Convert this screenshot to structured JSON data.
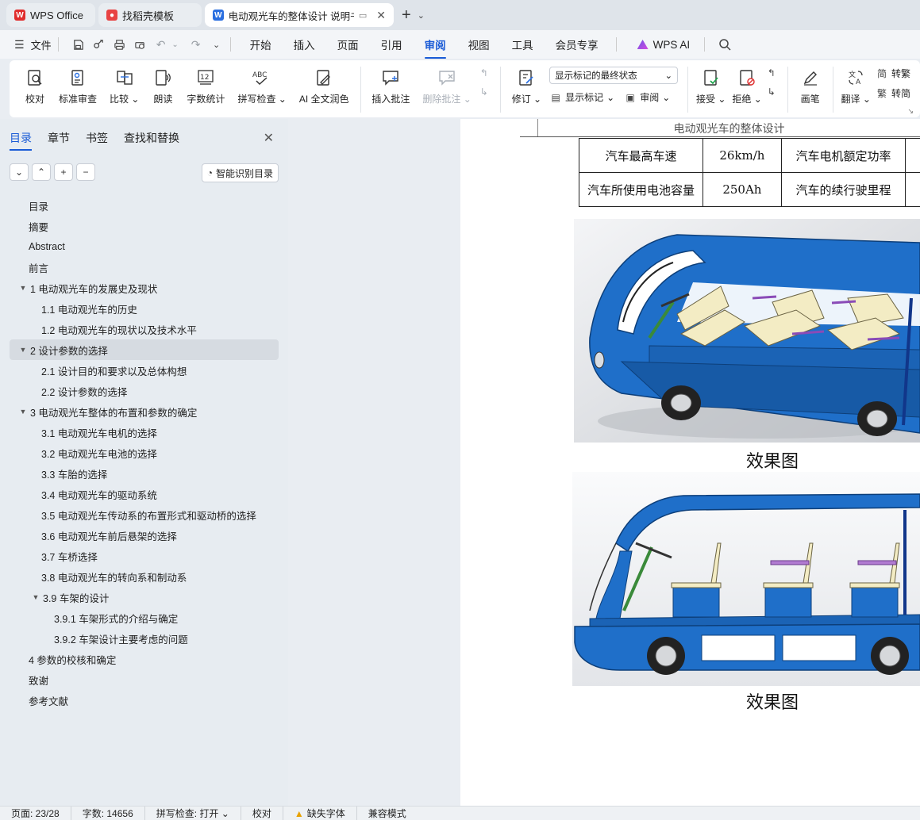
{
  "tabs": [
    {
      "label": "WPS Office",
      "icon": "wps-logo-icon",
      "color": "#e02d2d"
    },
    {
      "label": "找稻壳模板",
      "icon": "docer-logo-icon",
      "color": "#e84343"
    },
    {
      "label": "电动观光车的整体设计 说明书",
      "icon": "word-logo-icon",
      "color": "#2a6fe0"
    }
  ],
  "menu": {
    "file": "文件",
    "items": [
      "开始",
      "插入",
      "页面",
      "引用",
      "审阅",
      "视图",
      "工具",
      "会员专享"
    ],
    "active": "审阅",
    "ai": "WPS AI"
  },
  "ribbon": {
    "proofread": "校对",
    "std_review": "标准审查",
    "compare": "比较",
    "read_aloud": "朗读",
    "word_count": "字数统计",
    "spell_check": "拼写检查",
    "ai_polish": "AI 全文润色",
    "insert_comment": "插入批注",
    "delete_comment": "删除批注",
    "track_changes": "修订",
    "markup_select": "显示标记的最终状态",
    "show_markup": "显示标记",
    "review_pane": "审阅",
    "accept": "接受",
    "reject": "拒绝",
    "ink": "画笔",
    "translate": "翻译",
    "to_traditional": "转繁",
    "to_simplified": "转简"
  },
  "panel": {
    "tabs": [
      "目录",
      "章节",
      "书签",
      "查找和替换"
    ],
    "smart_toc": "智能识别目录",
    "toc": [
      {
        "level": 0,
        "label": "目录",
        "caret": ""
      },
      {
        "level": 0,
        "label": "摘要",
        "caret": ""
      },
      {
        "level": 0,
        "label": "Abstract",
        "caret": ""
      },
      {
        "level": 0,
        "label": "前言",
        "caret": ""
      },
      {
        "level": 0,
        "label": "1 电动观光车的发展史及现状",
        "caret": "▼"
      },
      {
        "level": 1,
        "label": "1.1 电动观光车的历史",
        "caret": ""
      },
      {
        "level": 1,
        "label": "1.2 电动观光车的现状以及技术水平",
        "caret": ""
      },
      {
        "level": 0,
        "label": "2 设计参数的选择",
        "caret": "▼",
        "selected": true
      },
      {
        "level": 1,
        "label": "2.1 设计目的和要求以及总体构想",
        "caret": ""
      },
      {
        "level": 1,
        "label": "2.2 设计参数的选择",
        "caret": ""
      },
      {
        "level": 0,
        "label": "3 电动观光车整体的布置和参数的确定",
        "caret": "▼"
      },
      {
        "level": 1,
        "label": "3.1 电动观光车电机的选择",
        "caret": ""
      },
      {
        "level": 1,
        "label": "3.2 电动观光车电池的选择",
        "caret": ""
      },
      {
        "level": 1,
        "label": "3.3 车胎的选择",
        "caret": ""
      },
      {
        "level": 1,
        "label": "3.4 电动观光车的驱动系统",
        "caret": ""
      },
      {
        "level": 1,
        "label": "3.5 电动观光车传动系的布置形式和驱动桥的选择",
        "caret": ""
      },
      {
        "level": 1,
        "label": "3.6 电动观光车前后悬架的选择",
        "caret": ""
      },
      {
        "level": 1,
        "label": "3.7 车桥选择",
        "caret": ""
      },
      {
        "level": 1,
        "label": "3.8 电动观光车的转向系和制动系",
        "caret": ""
      },
      {
        "level": 1,
        "label": "3.9 车架的设计",
        "caret": "▼"
      },
      {
        "level": 2,
        "label": "3.9.1 车架形式的介绍与确定",
        "caret": ""
      },
      {
        "level": 2,
        "label": "3.9.2 车架设计主要考虑的问题",
        "caret": ""
      },
      {
        "level": 0,
        "label": "4 参数的校核和确定",
        "caret": ""
      },
      {
        "level": 0,
        "label": "致谢",
        "caret": ""
      },
      {
        "level": 0,
        "label": "参考文献",
        "caret": ""
      }
    ]
  },
  "document": {
    "header": "电动观光车的整体设计",
    "table": [
      [
        "汽车最高车速",
        "26km/h",
        "汽车电机额定功率"
      ],
      [
        "汽车所使用电池容量",
        "250Ah",
        "汽车的续行驶里程"
      ]
    ],
    "caption1": "效果图",
    "caption2": "效果图"
  },
  "status": {
    "page": "页面: 23/28",
    "words": "字数: 14656",
    "spell": "拼写检查: 打开",
    "proof": "校对",
    "missing_font": "缺失字体",
    "compat": "兼容模式"
  },
  "colors": {
    "accent": "#1a5bd6",
    "bus_blue": "#1f6fc9",
    "seat": "#f3ecc4"
  }
}
